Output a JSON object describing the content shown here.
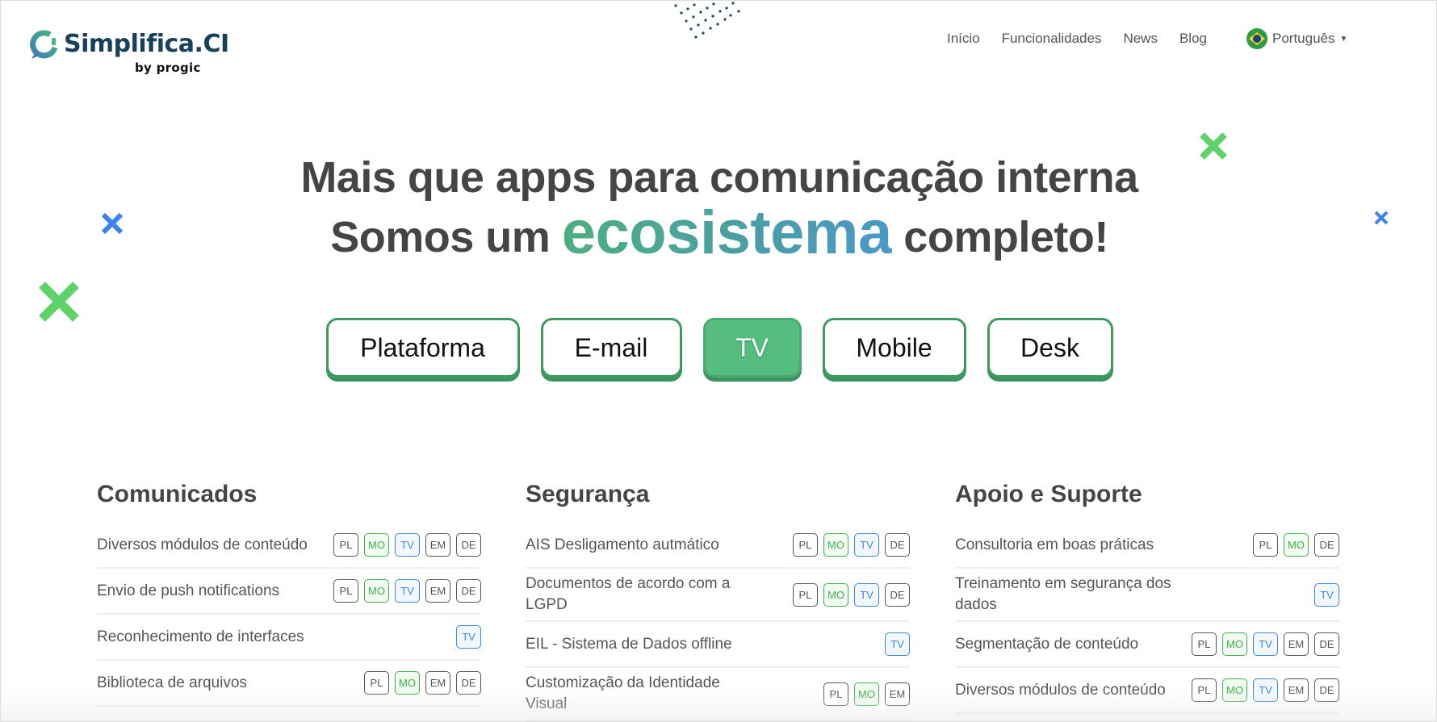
{
  "brand": {
    "name": "Simplifica.CI",
    "sub": "by progic",
    "colors": {
      "primary": "#17405a",
      "green": "#55be7f",
      "blue": "#3a87d6"
    }
  },
  "nav": {
    "items": [
      "Início",
      "Funcionalidades",
      "News",
      "Blog"
    ],
    "language": "Português",
    "language_icon": "brazil-flag-icon"
  },
  "hero": {
    "line1": "Mais que apps para comunicação interna",
    "line2_pre": "Somos um",
    "line2_highlight": "ecosistema",
    "line2_post": "completo!"
  },
  "tabs": [
    {
      "label": "Plataforma",
      "active": false
    },
    {
      "label": "E-mail",
      "active": false
    },
    {
      "label": "TV",
      "active": true
    },
    {
      "label": "Mobile",
      "active": false
    },
    {
      "label": "Desk",
      "active": false
    }
  ],
  "sections": [
    {
      "title": "Comunicados",
      "rows": [
        {
          "label": "Diversos módulos de conteúdo",
          "badges": [
            "PL",
            "MO",
            "TV",
            "EM",
            "DE"
          ]
        },
        {
          "label": "Envio de push notifications",
          "badges": [
            "PL",
            "MO",
            "TV",
            "EM",
            "DE"
          ]
        },
        {
          "label": "Reconhecimento de interfaces",
          "badges": [
            "TV"
          ]
        },
        {
          "label": "Biblioteca de arquivos",
          "badges": [
            "PL",
            "MO",
            "EM",
            "DE"
          ]
        }
      ]
    },
    {
      "title": "Segurança",
      "rows": [
        {
          "label": "AIS Desligamento autmático",
          "badges": [
            "PL",
            "MO",
            "TV",
            "DE"
          ]
        },
        {
          "label": "Documentos de acordo com a LGPD",
          "badges": [
            "PL",
            "MO",
            "TV",
            "DE"
          ]
        },
        {
          "label": "EIL - Sistema de Dados offline",
          "badges": [
            "TV"
          ]
        },
        {
          "label": "Customização da Identidade Visual",
          "badges": [
            "PL",
            "MO",
            "EM"
          ]
        }
      ]
    },
    {
      "title": "Apoio e Suporte",
      "rows": [
        {
          "label": "Consultoria em boas práticas",
          "badges": [
            "PL",
            "MO",
            "DE"
          ]
        },
        {
          "label": "Treinamento em segurança dos dados",
          "badges": [
            "TV"
          ]
        },
        {
          "label": "Segmentação de conteúdo",
          "badges": [
            "PL",
            "MO",
            "TV",
            "EM",
            "DE"
          ]
        },
        {
          "label": "Diversos módulos de conteúdo",
          "badges": [
            "PL",
            "MO",
            "TV",
            "EM",
            "DE"
          ]
        }
      ]
    }
  ]
}
